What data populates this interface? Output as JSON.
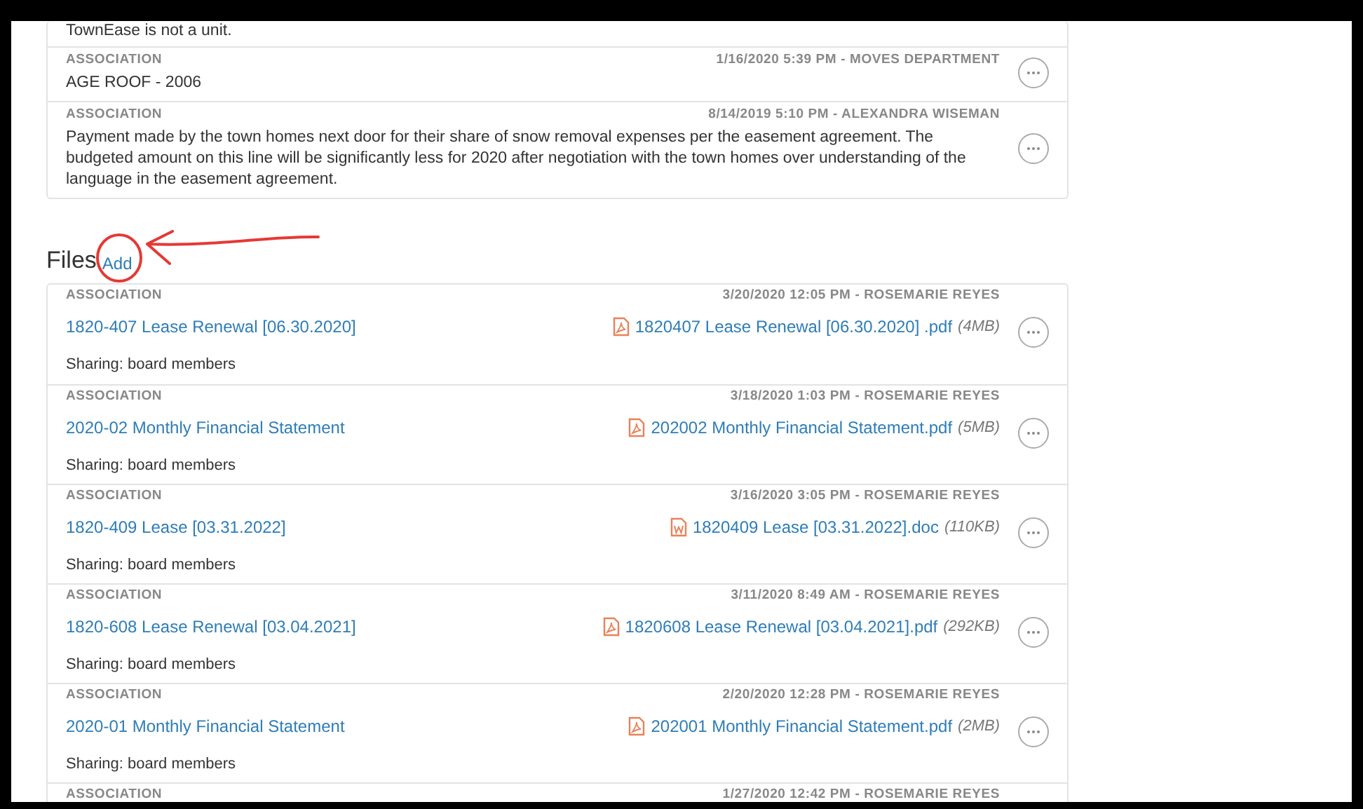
{
  "notes": [
    {
      "text": "TownEase is not a unit."
    },
    {
      "label": "ASSOCIATION",
      "meta": "1/16/2020 5:39 PM - MOVES DEPARTMENT",
      "text": "AGE ROOF  - 2006"
    },
    {
      "label": "ASSOCIATION",
      "meta": "8/14/2019 5:10 PM - ALEXANDRA WISEMAN",
      "text": "Payment made by the town homes next door for their share of snow removal expenses per the easement agreement. The budgeted amount on this line will be significantly less for 2020 after negotiation with the town homes over understanding of the language in the easement agreement."
    }
  ],
  "files_section": {
    "title": "Files",
    "add_link": "Add"
  },
  "files": [
    {
      "label": "ASSOCIATION",
      "meta": "3/20/2020 12:05 PM - ROSEMARIE REYES",
      "title": "1820-407 Lease Renewal [06.30.2020]",
      "kind": "pdf",
      "file_name": "1820407 Lease Renewal [06.30.2020] .pdf",
      "file_size": "(4MB)",
      "sharing": "Sharing: board members"
    },
    {
      "label": "ASSOCIATION",
      "meta": "3/18/2020 1:03 PM - ROSEMARIE REYES",
      "title": "2020-02 Monthly Financial Statement",
      "kind": "pdf",
      "file_name": "202002 Monthly Financial Statement.pdf",
      "file_size": "(5MB)",
      "sharing": "Sharing: board members"
    },
    {
      "label": "ASSOCIATION",
      "meta": "3/16/2020 3:05 PM - ROSEMARIE REYES",
      "title": "1820-409 Lease [03.31.2022]",
      "kind": "doc",
      "file_name": "1820409 Lease [03.31.2022].doc",
      "file_size": "(110KB)",
      "sharing": "Sharing: board members"
    },
    {
      "label": "ASSOCIATION",
      "meta": "3/11/2020 8:49 AM - ROSEMARIE REYES",
      "title": "1820-608 Lease Renewal [03.04.2021]",
      "kind": "pdf",
      "file_name": "1820608 Lease Renewal [03.04.2021].pdf",
      "file_size": "(292KB)",
      "sharing": "Sharing: board members"
    },
    {
      "label": "ASSOCIATION",
      "meta": "2/20/2020 12:28 PM - ROSEMARIE REYES",
      "title": "2020-01 Monthly Financial Statement",
      "kind": "pdf",
      "file_name": "202001 Monthly Financial Statement.pdf",
      "file_size": "(2MB)",
      "sharing": "Sharing: board members"
    },
    {
      "label": "ASSOCIATION",
      "meta": "1/27/2020 12:42 PM - ROSEMARIE REYES"
    }
  ]
}
